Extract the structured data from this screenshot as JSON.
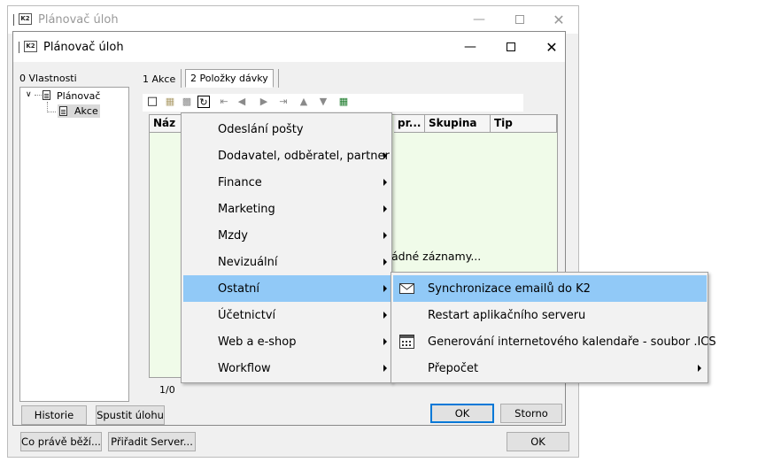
{
  "outer_window": {
    "title": "Plánovač úloh",
    "logo": "K2",
    "buttons": {
      "running": "Co právě běží...",
      "assign_server": "Přiřadit Server...",
      "ok": "OK"
    }
  },
  "inner_window": {
    "title": "Plánovač úloh",
    "logo": "K2",
    "properties_label": "0 Vlastnosti",
    "tree": {
      "root": "Plánovač",
      "child": "Akce"
    },
    "tabs": [
      "1 Akce",
      "2 Položky dávky"
    ],
    "grid": {
      "columns": [
        "Náz",
        "pr...",
        "Skupina",
        "Tip"
      ],
      "empty_text": "ádné záznamy...",
      "record_count": "1/0"
    },
    "buttons": {
      "history": "Historie",
      "run_task": "Spustit úlohu",
      "ok": "OK",
      "cancel": "Storno"
    }
  },
  "context_menu": {
    "items": [
      {
        "label": "Odeslání pošty",
        "submenu": false
      },
      {
        "label": "Dodavatel, odběratel, partner",
        "submenu": true
      },
      {
        "label": "Finance",
        "submenu": true
      },
      {
        "label": "Marketing",
        "submenu": true
      },
      {
        "label": "Mzdy",
        "submenu": true
      },
      {
        "label": "Nevizuální",
        "submenu": true
      },
      {
        "label": "Ostatní",
        "submenu": true,
        "highlighted": true
      },
      {
        "label": "Účetnictví",
        "submenu": true
      },
      {
        "label": "Web a e-shop",
        "submenu": true
      },
      {
        "label": "Workflow",
        "submenu": true
      }
    ]
  },
  "submenu": {
    "items": [
      {
        "label": "Synchronizace emailů do K2",
        "icon": "envelope-icon",
        "highlighted": true
      },
      {
        "label": "Restart aplikačního serveru",
        "icon": ""
      },
      {
        "label": "Generování internetového kalendaře - soubor .ICS",
        "icon": "calendar-icon"
      },
      {
        "label": "Přepočet",
        "icon": "",
        "submenu": true
      }
    ]
  },
  "colors": {
    "highlight": "#91c9f7",
    "grid_bg": "#f0fbe9",
    "default_border": "#0078d7"
  }
}
